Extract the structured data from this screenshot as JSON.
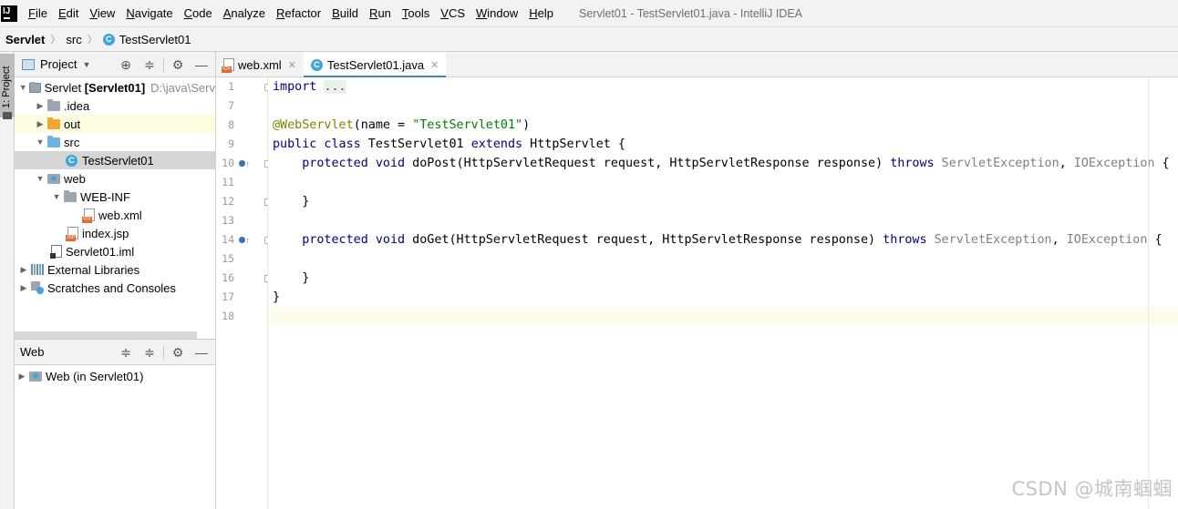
{
  "menubar": {
    "items": [
      "File",
      "Edit",
      "View",
      "Navigate",
      "Code",
      "Analyze",
      "Refactor",
      "Build",
      "Run",
      "Tools",
      "VCS",
      "Window",
      "Help"
    ],
    "window_title": "Servlet01 - TestServlet01.java - IntelliJ IDEA"
  },
  "breadcrumb": {
    "project": "Servlet",
    "folder": "src",
    "file": "TestServlet01"
  },
  "tool_strip": {
    "project_tab": "1: Project"
  },
  "project_panel": {
    "title": "Project",
    "tree": [
      {
        "label": "Servlet",
        "bold": "[Servlet01]",
        "path": "D:\\java\\Serv"
      },
      {
        "label": ".idea"
      },
      {
        "label": "out"
      },
      {
        "label": "src"
      },
      {
        "label": "TestServlet01"
      },
      {
        "label": "web"
      },
      {
        "label": "WEB-INF"
      },
      {
        "label": "web.xml"
      },
      {
        "label": "index.jsp"
      },
      {
        "label": "Servlet01.iml"
      },
      {
        "label": "External Libraries"
      },
      {
        "label": "Scratches and Consoles"
      }
    ]
  },
  "web_panel": {
    "title": "Web",
    "item": "Web (in Servlet01)"
  },
  "editor": {
    "tabs": [
      "web.xml",
      "TestServlet01.java"
    ],
    "active_tab": "TestServlet01.java",
    "line_numbers": [
      "1",
      "7",
      "8",
      "9",
      "10",
      "11",
      "12",
      "13",
      "14",
      "15",
      "16",
      "17",
      "18"
    ],
    "code": {
      "l1_kw": "import",
      "l1_fold": "...",
      "l8_ann": "@WebServlet",
      "l8_open": "(name = ",
      "l8_str": "\"TestServlet01\"",
      "l8_close": ")",
      "l9_kw": "public class",
      "l9_name": " TestServlet01 ",
      "l9_kw2": "extends",
      "l9_rest": " HttpServlet {",
      "l10_kw": "protected void",
      "l10_sig": " doPost(HttpServletRequest request, HttpServletResponse response) ",
      "l10_throws": "throws",
      "l10_ex1": " ServletException",
      "l10_comma": ", ",
      "l10_ex2": "IOException",
      "l10_brace": " {",
      "l12": "}",
      "l14_kw": "protected void",
      "l14_sig": " doGet(HttpServletRequest request, HttpServletResponse response) ",
      "l14_throws": "throws",
      "l14_ex1": " ServletException",
      "l14_comma": ", ",
      "l14_ex2": "IOException",
      "l14_brace": " {",
      "l16": "}",
      "l17": "}"
    }
  },
  "watermark": "CSDN @城南蝈蝈",
  "colors": {
    "keyword": "#000080",
    "annotation": "#808000",
    "string": "#008000",
    "active_tab_underline": "#4083c9",
    "current_line": "#fdfbe9"
  }
}
